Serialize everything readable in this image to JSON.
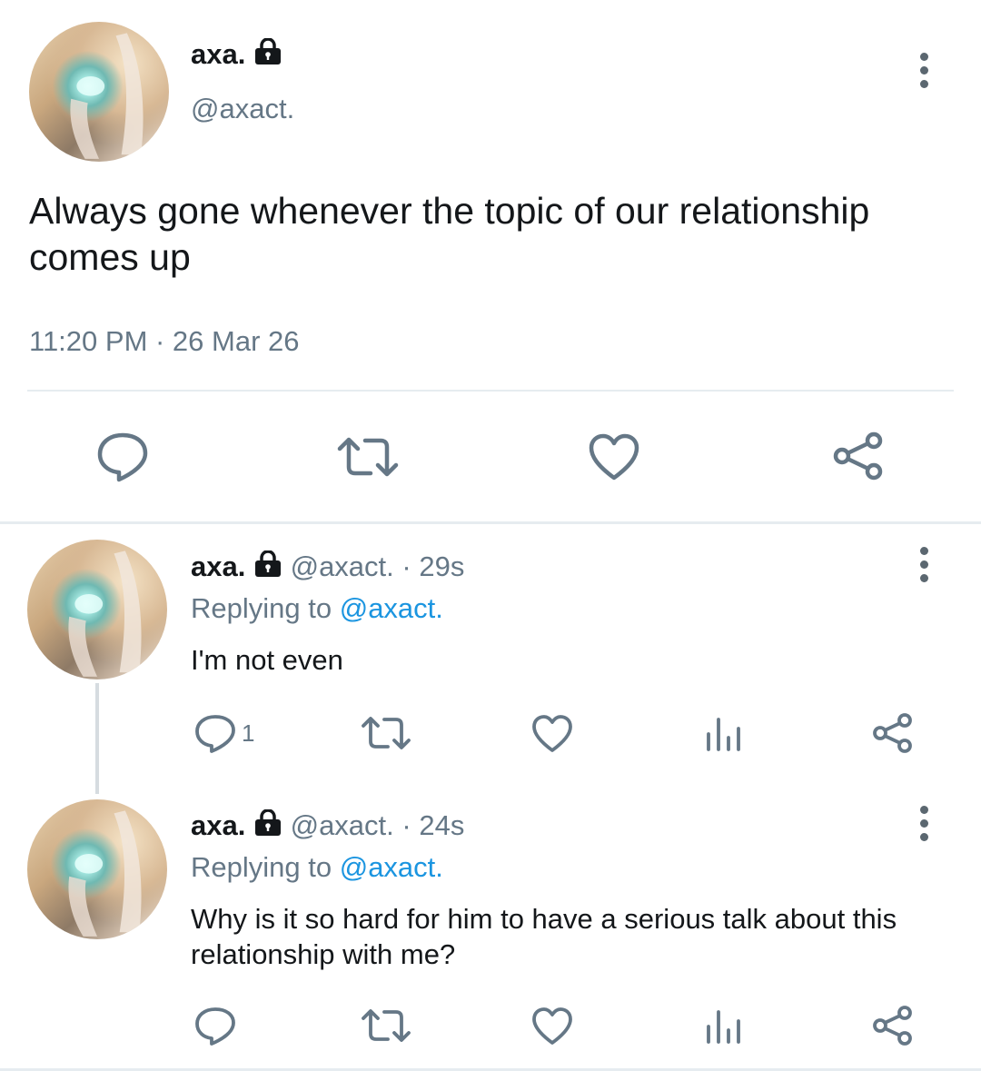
{
  "main_tweet": {
    "display_name": "axa.",
    "handle": "@axact.",
    "text": "Always gone whenever the topic of our relationship comes up",
    "timestamp": "11:20 PM · 26 Mar 26",
    "actions": [
      "reply-icon",
      "retweet-icon",
      "like-icon",
      "share-icon"
    ]
  },
  "replies": [
    {
      "display_name": "axa.",
      "handle": "@axact.",
      "age": "· 29s",
      "replying_prefix": "Replying to",
      "replying_handle": "@axact.",
      "text": "I'm not even",
      "reply_count": "1"
    },
    {
      "display_name": "axa.",
      "handle": "@axact.",
      "age": "· 24s",
      "replying_prefix": "Replying to",
      "replying_handle": "@axact.",
      "text": "Why is it so hard for him to have a serious talk about this relationship with me?",
      "reply_count": ""
    }
  ],
  "colors": {
    "text": "#14171a",
    "muted": "#657786",
    "link": "#1b95e0",
    "divider": "#e6ecf0"
  }
}
